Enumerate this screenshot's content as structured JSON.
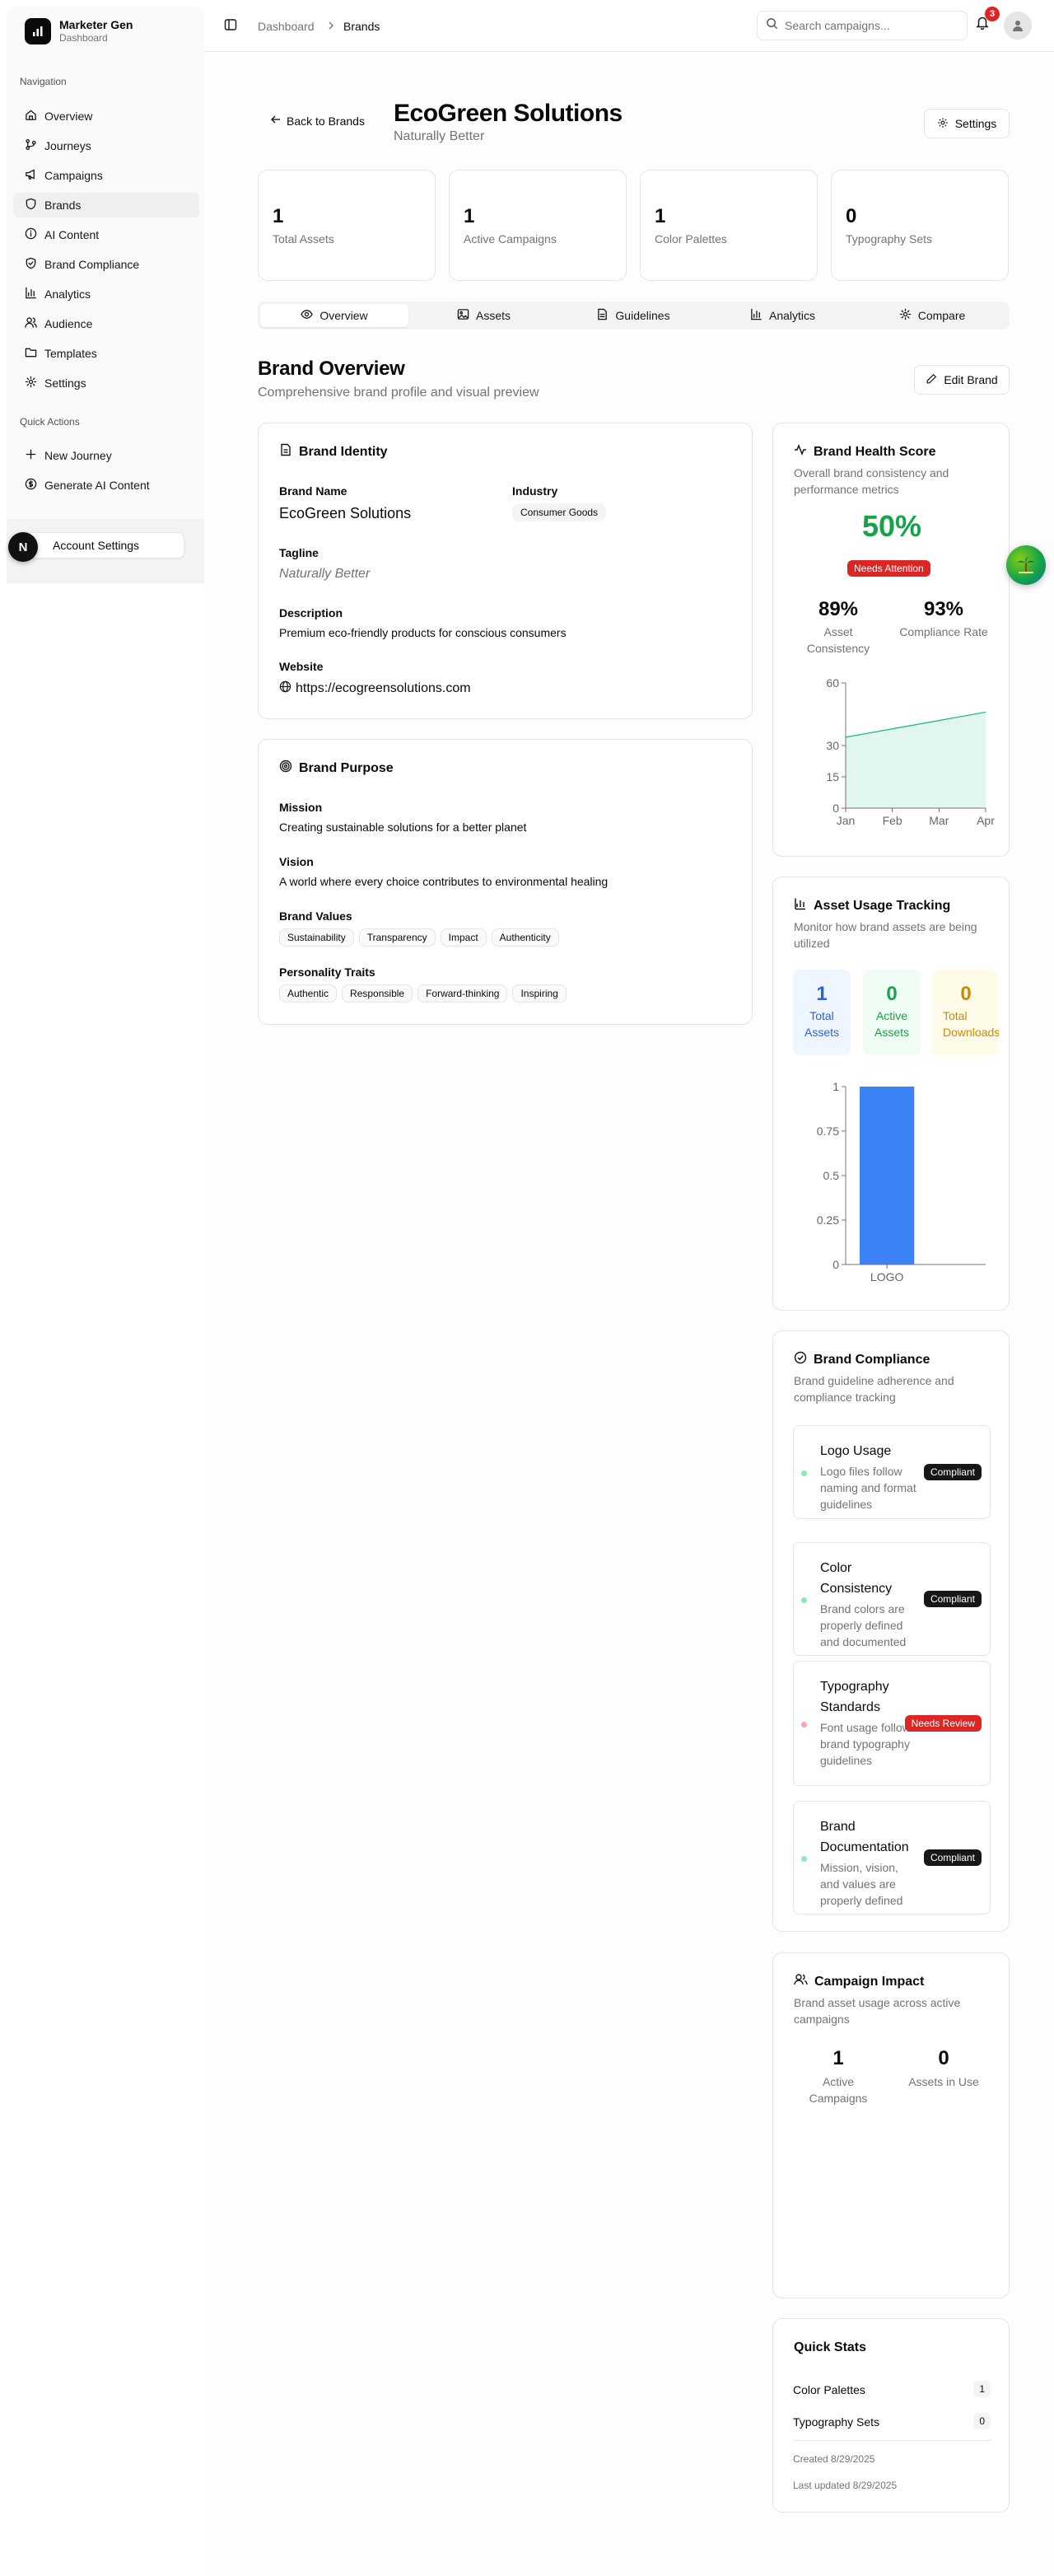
{
  "app": {
    "name": "Marketer Gen",
    "subtitle": "Dashboard"
  },
  "sidebar": {
    "navigation_label": "Navigation",
    "items": [
      {
        "label": "Overview",
        "icon": "home-icon"
      },
      {
        "label": "Journeys",
        "icon": "git-branch-icon"
      },
      {
        "label": "Campaigns",
        "icon": "megaphone-icon"
      },
      {
        "label": "Brands",
        "icon": "shield-icon",
        "active": true
      },
      {
        "label": "AI Content",
        "icon": "info-circle-icon"
      },
      {
        "label": "Brand Compliance",
        "icon": "shield-check-icon"
      },
      {
        "label": "Analytics",
        "icon": "bar-chart-icon"
      },
      {
        "label": "Audience",
        "icon": "users-icon"
      },
      {
        "label": "Templates",
        "icon": "folder-icon"
      },
      {
        "label": "Settings",
        "icon": "gear-icon"
      }
    ],
    "quick_actions_label": "Quick Actions",
    "quick_actions": [
      {
        "label": "New Journey",
        "icon": "plus-icon"
      },
      {
        "label": "Generate AI Content",
        "icon": "dollar-circle-icon"
      }
    ],
    "account_settings": "Account Settings",
    "avatar_letter": "N"
  },
  "topbar": {
    "breadcrumb": [
      "Dashboard",
      "Brands"
    ],
    "search_placeholder": "Search campaigns...",
    "notification_count": "3"
  },
  "header": {
    "back_label": "Back to Brands",
    "title": "EcoGreen Solutions",
    "tagline": "Naturally Better",
    "settings_label": "Settings"
  },
  "stats": [
    {
      "value": "1",
      "label": "Total Assets"
    },
    {
      "value": "1",
      "label": "Active Campaigns"
    },
    {
      "value": "1",
      "label": "Color Palettes"
    },
    {
      "value": "0",
      "label": "Typography Sets"
    }
  ],
  "tabs": [
    {
      "label": "Overview",
      "icon": "eye-icon",
      "active": true
    },
    {
      "label": "Assets",
      "icon": "image-icon"
    },
    {
      "label": "Guidelines",
      "icon": "file-text-icon"
    },
    {
      "label": "Analytics",
      "icon": "bar-chart-icon"
    },
    {
      "label": "Compare",
      "icon": "gear-icon"
    }
  ],
  "overview": {
    "title": "Brand Overview",
    "subtitle": "Comprehensive brand profile and visual preview",
    "edit_label": "Edit Brand"
  },
  "identity": {
    "title": "Brand Identity",
    "name_label": "Brand Name",
    "name": "EcoGreen Solutions",
    "industry_label": "Industry",
    "industry": "Consumer Goods",
    "tagline_label": "Tagline",
    "tagline": "Naturally Better",
    "description_label": "Description",
    "description": "Premium eco-friendly products for conscious consumers",
    "website_label": "Website",
    "website": "https://ecogreensolutions.com"
  },
  "purpose": {
    "title": "Brand Purpose",
    "mission_label": "Mission",
    "mission": "Creating sustainable solutions for a better planet",
    "vision_label": "Vision",
    "vision": "A world where every choice contributes to environmental healing",
    "values_label": "Brand Values",
    "values": [
      "Sustainability",
      "Transparency",
      "Impact",
      "Authenticity"
    ],
    "traits_label": "Personality Traits",
    "traits": [
      "Authentic",
      "Responsible",
      "Forward-thinking",
      "Inspiring"
    ]
  },
  "health": {
    "title": "Brand Health Score",
    "description": "Overall brand consistency and performance metrics",
    "score": "50%",
    "status": "Needs Attention",
    "asset_consistency": "89%",
    "asset_consistency_label": "Asset Consistency",
    "compliance_rate": "93%",
    "compliance_rate_label": "Compliance Rate"
  },
  "asset_usage": {
    "title": "Asset Usage Tracking",
    "description": "Monitor how brand assets are being utilized",
    "total": "1",
    "total_label": "Total Assets",
    "active": "0",
    "active_label": "Active Assets",
    "downloads": "0",
    "downloads_label": "Total Downloads"
  },
  "compliance": {
    "title": "Brand Compliance",
    "description": "Brand guideline adherence and compliance tracking",
    "items": [
      {
        "title": "Logo Usage",
        "desc": "Logo files follow naming and format guidelines",
        "status": "Compliant"
      },
      {
        "title": "Color Consistency",
        "desc": "Brand colors are properly defined and documented",
        "status": "Compliant"
      },
      {
        "title": "Typography Standards",
        "desc": "Font usage follows brand typography guidelines",
        "status": "Needs Review"
      },
      {
        "title": "Brand Documentation",
        "desc": "Mission, vision, and values are properly defined",
        "status": "Compliant"
      }
    ]
  },
  "campaign_impact": {
    "title": "Campaign Impact",
    "description": "Brand asset usage across active campaigns",
    "active_campaigns": "1",
    "active_campaigns_label": "Active Campaigns",
    "assets_in_use": "0",
    "assets_in_use_label": "Assets in Use"
  },
  "quick_stats": {
    "title": "Quick Stats",
    "color_palettes_label": "Color Palettes",
    "color_palettes": "1",
    "typography_label": "Typography Sets",
    "typography": "0",
    "created": "Created 8/29/2025",
    "updated": "Last updated 8/29/2025"
  },
  "colors": {
    "accent_green": "#16a34a",
    "danger": "#dc2626",
    "bar_blue": "#3b82f6",
    "area_green": "#10b981"
  },
  "chart_data": [
    {
      "type": "area",
      "categories": [
        "Jan",
        "Feb",
        "Mar",
        "Apr"
      ],
      "values": [
        34,
        38,
        42,
        46
      ],
      "yticks": [
        0,
        15,
        30,
        60
      ],
      "ylim": [
        0,
        60
      ],
      "title": "",
      "xlabel": "",
      "ylabel": ""
    },
    {
      "type": "bar",
      "categories": [
        "LOGO"
      ],
      "values": [
        1
      ],
      "yticks": [
        0,
        0.25,
        0.5,
        0.75,
        1
      ],
      "ylim": [
        0,
        1
      ],
      "title": "",
      "xlabel": "",
      "ylabel": ""
    }
  ]
}
